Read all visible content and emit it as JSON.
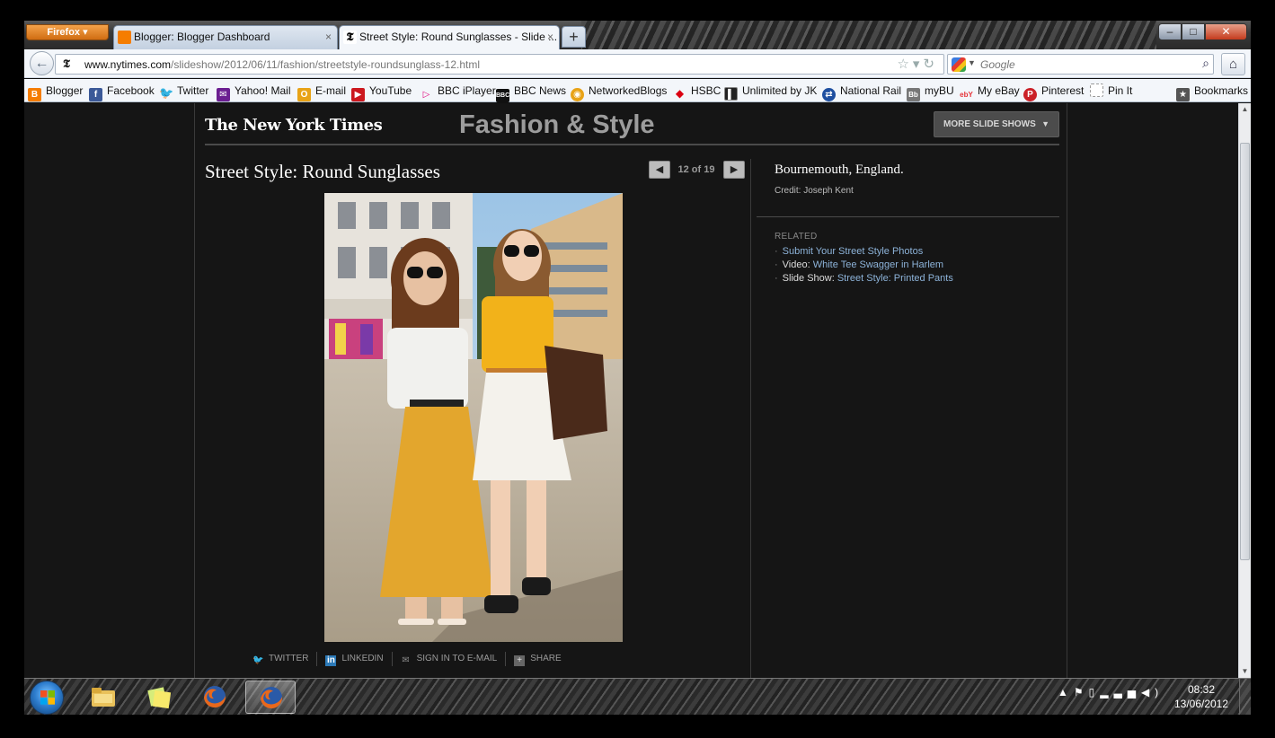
{
  "browser": {
    "menu_label": "Firefox",
    "tabs": [
      {
        "title": "Blogger: Blogger Dashboard",
        "close": "×"
      },
      {
        "title": "Street Style: Round Sunglasses - Slide ...",
        "close": "×"
      }
    ],
    "new_tab": "+",
    "window_buttons": {
      "minimize": "–",
      "maximize": "□",
      "close": "✕"
    },
    "url_domain": "www.nytimes.com",
    "url_path": "/slideshow/2012/06/11/fashion/streetstyle-roundsunglass-12.html",
    "search_placeholder": "Google"
  },
  "bookmarks": {
    "items": [
      {
        "label": "Blogger",
        "icon": "blogger-icon",
        "color": "#f57d00"
      },
      {
        "label": "Facebook",
        "icon": "facebook-icon",
        "color": "#3b5998"
      },
      {
        "label": "Twitter",
        "icon": "twitter-icon",
        "color": "#2aa9e0"
      },
      {
        "label": "Yahoo! Mail",
        "icon": "yahoo-mail-icon",
        "color": "#6b1e91"
      },
      {
        "label": "E-mail",
        "icon": "email-icon",
        "color": "#e8a317"
      },
      {
        "label": "YouTube",
        "icon": "youtube-icon",
        "color": "#cc181e"
      },
      {
        "label": "BBC iPlayer",
        "icon": "bbc-iplayer-icon",
        "color": "#e0007a"
      },
      {
        "label": "BBC News",
        "icon": "bbc-news-icon",
        "color": "#111111"
      },
      {
        "label": "NetworkedBlogs",
        "icon": "networkedblogs-icon",
        "color": "#e8a317"
      },
      {
        "label": "HSBC",
        "icon": "hsbc-icon",
        "color": "#db0011"
      },
      {
        "label": "Unlimited by JK",
        "icon": "unlimited-icon",
        "color": "#222222"
      },
      {
        "label": "National Rail",
        "icon": "national-rail-icon",
        "color": "#1e4fa0"
      },
      {
        "label": "myBU",
        "icon": "mybu-icon",
        "color": "#777777"
      },
      {
        "label": "My eBay",
        "icon": "ebay-icon",
        "color": "#e53238"
      },
      {
        "label": "Pinterest",
        "icon": "pinterest-icon",
        "color": "#cb2027"
      },
      {
        "label": "Pin It",
        "icon": "pin-it-icon",
        "color": "#ffffff"
      }
    ],
    "bookmarks_menu": "Bookmarks"
  },
  "page": {
    "logo": "The New York Times",
    "section": "Fashion & Style",
    "more_slide_shows": "MORE SLIDE SHOWS",
    "slideshow_title": "Street Style: Round Sunglasses",
    "counter": "12 of 19",
    "prev": "◀",
    "next": "▶",
    "location": "Bournemouth, England.",
    "credit": "Credit: Joseph Kent",
    "related_label": "RELATED",
    "related": [
      {
        "prefix": "",
        "link": "Submit Your Street Style Photos"
      },
      {
        "prefix": "Video: ",
        "link": "White Tee Swagger in Harlem"
      },
      {
        "prefix": "Slide Show: ",
        "link": "Street Style: Printed Pants"
      }
    ],
    "share": [
      {
        "label": "TWITTER",
        "icon": "twitter-icon"
      },
      {
        "label": "LINKEDIN",
        "icon": "linkedin-icon"
      },
      {
        "label": "SIGN IN TO E-MAIL",
        "icon": "email-icon"
      },
      {
        "label": "SHARE",
        "icon": "plus-icon"
      }
    ]
  },
  "taskbar": {
    "time": "08:32",
    "date": "13/06/2012",
    "apps": [
      "windows-explorer",
      "sticky-notes",
      "firefox",
      "firefox-active"
    ]
  }
}
